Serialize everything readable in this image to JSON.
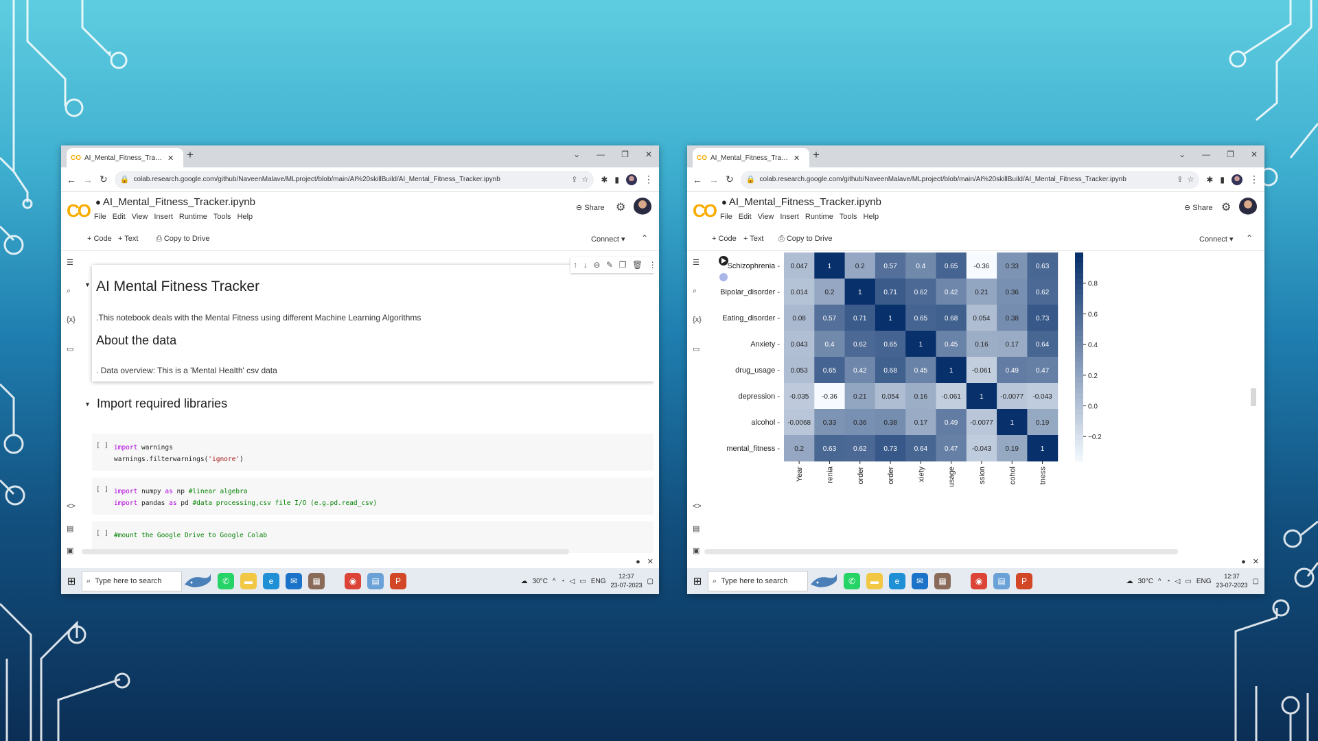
{
  "browser": {
    "tab_title": "AI_Mental_Fitness_Tracker.ipynb",
    "tab_logo": "CO",
    "url": "colab.research.google.com/github/NaveenMalave/MLproject/blob/main/AI%20skillBuild/AI_Mental_Fitness_Tracker.ipynb"
  },
  "colab": {
    "notebook_title": "AI_Mental_Fitness_Tracker.ipynb",
    "menus": [
      "File",
      "Edit",
      "View",
      "Insert",
      "Runtime",
      "Tools",
      "Help"
    ],
    "share_label": "Share",
    "toolbar": {
      "code": "+ Code",
      "text": "+ Text",
      "copy": "Copy to Drive",
      "connect": "Connect"
    }
  },
  "left_notebook": {
    "heading1": "AI Mental Fitness Tracker",
    "paragraph": ".This notebook deals with the Mental Fitness using different Machine Learning Algorithms",
    "heading2": "About the data",
    "paragraph2": ". Data overview: This is a 'Mental Health' csv data",
    "section_heading": "Import required libraries",
    "cells": [
      {
        "lines": [
          [
            {
              "t": "import",
              "c": "kw"
            },
            {
              "t": " warnings",
              "c": ""
            }
          ],
          [
            {
              "t": "warnings.filterwarnings(",
              "c": ""
            },
            {
              "t": "'ignore'",
              "c": "str"
            },
            {
              "t": ")",
              "c": ""
            }
          ]
        ]
      },
      {
        "lines": [
          [
            {
              "t": "import",
              "c": "kw"
            },
            {
              "t": " numpy ",
              "c": ""
            },
            {
              "t": "as",
              "c": "kw"
            },
            {
              "t": " np ",
              "c": ""
            },
            {
              "t": "#linear algebra",
              "c": "cmt"
            }
          ],
          [
            {
              "t": "import",
              "c": "kw"
            },
            {
              "t": " pandas ",
              "c": ""
            },
            {
              "t": "as",
              "c": "kw"
            },
            {
              "t": " pd ",
              "c": ""
            },
            {
              "t": "#data processing,csv file I/O (e.g.pd.read_csv)",
              "c": "cmt"
            }
          ]
        ]
      },
      {
        "lines": [
          [
            {
              "t": "#mount the Google Drive to Google Colab",
              "c": "cmt"
            }
          ]
        ]
      }
    ],
    "run_bracket": "[ ]"
  },
  "chart_data": {
    "type": "heatmap",
    "rows": [
      "Schizophrenia",
      "Bipolar_disorder",
      "Eating_disorder",
      "Anxiety",
      "drug_usage",
      "depression",
      "alcohol",
      "mental_fitness"
    ],
    "columns": [
      "Year",
      "Schizophrenia",
      "Bipolar_disorder",
      "Eating_disorder",
      "Anxiety",
      "drug_usage",
      "depression",
      "alcohol",
      "mental_fitness"
    ],
    "visible_column_labels": [
      "Year",
      "renia",
      "order",
      "order",
      "xiety",
      "usage",
      "ssion",
      "cohol",
      "tness"
    ],
    "values": [
      [
        0.047,
        1,
        0.2,
        0.57,
        0.4,
        0.65,
        -0.36,
        0.33,
        0.63
      ],
      [
        0.014,
        0.2,
        1,
        0.71,
        0.62,
        0.42,
        0.21,
        0.36,
        0.62
      ],
      [
        0.08,
        0.57,
        0.71,
        1,
        0.65,
        0.68,
        0.054,
        0.38,
        0.73
      ],
      [
        0.043,
        0.4,
        0.62,
        0.65,
        1,
        0.45,
        0.16,
        0.17,
        0.64
      ],
      [
        0.053,
        0.65,
        0.42,
        0.68,
        0.45,
        1,
        -0.061,
        0.49,
        0.47
      ],
      [
        -0.035,
        -0.36,
        0.21,
        0.054,
        0.16,
        -0.061,
        1,
        -0.0077,
        -0.043
      ],
      [
        -0.0068,
        0.33,
        0.36,
        0.38,
        0.17,
        0.49,
        -0.0077,
        1,
        0.19
      ],
      [
        0.2,
        0.63,
        0.62,
        0.73,
        0.64,
        0.47,
        -0.043,
        0.19,
        1
      ]
    ],
    "colorbar_ticks": [
      0.8,
      0.6,
      0.4,
      0.2,
      0.0,
      -0.2
    ],
    "colorbar_labels": [
      "0.8",
      "0.6",
      "0.4",
      "0.2",
      "0.0",
      "−0.2"
    ],
    "vmin": -0.36,
    "vmax": 1,
    "colormap": "Blues"
  },
  "taskbar": {
    "search_placeholder": "Type here to search",
    "weather": "30°C",
    "language": "ENG",
    "time": "12:37",
    "date": "23-07-2023"
  },
  "colors": {
    "accent": "#f9ab00",
    "heat_low": "#f7fbff",
    "heat_high": "#08306b"
  }
}
